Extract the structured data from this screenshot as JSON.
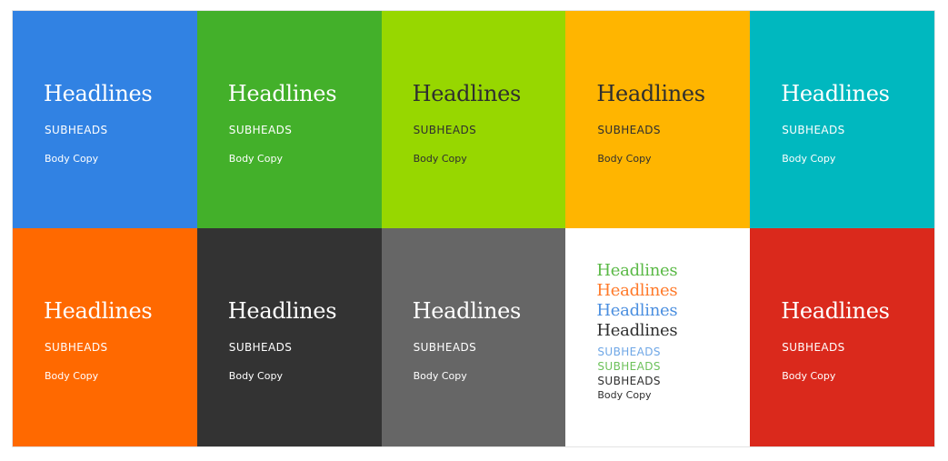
{
  "swatches": [
    {
      "color": "#3182e3",
      "text_color": "#ffffff",
      "headline": "Headlines",
      "subhead": "SUBHEADS",
      "body": "Body Copy"
    },
    {
      "color": "#43b02a",
      "text_color": "#ffffff",
      "headline": "Headlines",
      "subhead": "SUBHEADS",
      "body": "Body Copy"
    },
    {
      "color": "#97d700",
      "text_color": "#2f2f2f",
      "headline": "Headlines",
      "subhead": "SUBHEADS",
      "body": "Body Copy"
    },
    {
      "color": "#ffb500",
      "text_color": "#2f2f2f",
      "headline": "Headlines",
      "subhead": "SUBHEADS",
      "body": "Body Copy"
    },
    {
      "color": "#00b8bf",
      "text_color": "#ffffff",
      "headline": "Headlines",
      "subhead": "SUBHEADS",
      "body": "Body Copy"
    },
    {
      "color": "#ff6900",
      "text_color": "#ffffff",
      "headline": "Headlines",
      "subhead": "SUBHEADS",
      "body": "Body Copy"
    },
    {
      "color": "#333333",
      "text_color": "#ffffff",
      "headline": "Headlines",
      "subhead": "SUBHEADS",
      "body": "Body Copy"
    },
    {
      "color": "#666666",
      "text_color": "#ffffff",
      "headline": "Headlines",
      "subhead": "SUBHEADS",
      "body": "Body Copy"
    }
  ],
  "sample": {
    "color": "#ffffff",
    "headlines": [
      {
        "text": "Headlines",
        "color": "#5ab946"
      },
      {
        "text": "Headlines",
        "color": "#ff7a2a"
      },
      {
        "text": "Headlines",
        "color": "#4a8fe0"
      },
      {
        "text": "Headlines",
        "color": "#2f2f2f"
      }
    ],
    "subheads": [
      {
        "text": "SUBHEADS",
        "color": "#6fa7e6"
      },
      {
        "text": "SUBHEADS",
        "color": "#6cc15a"
      },
      {
        "text": "SUBHEADS",
        "color": "#2f2f2f"
      }
    ],
    "body": {
      "text": "Body Copy",
      "color": "#2f2f2f"
    }
  },
  "last": {
    "color": "#da291c",
    "text_color": "#ffffff",
    "headline": "Headlines",
    "subhead": "SUBHEADS",
    "body": "Body Copy"
  }
}
